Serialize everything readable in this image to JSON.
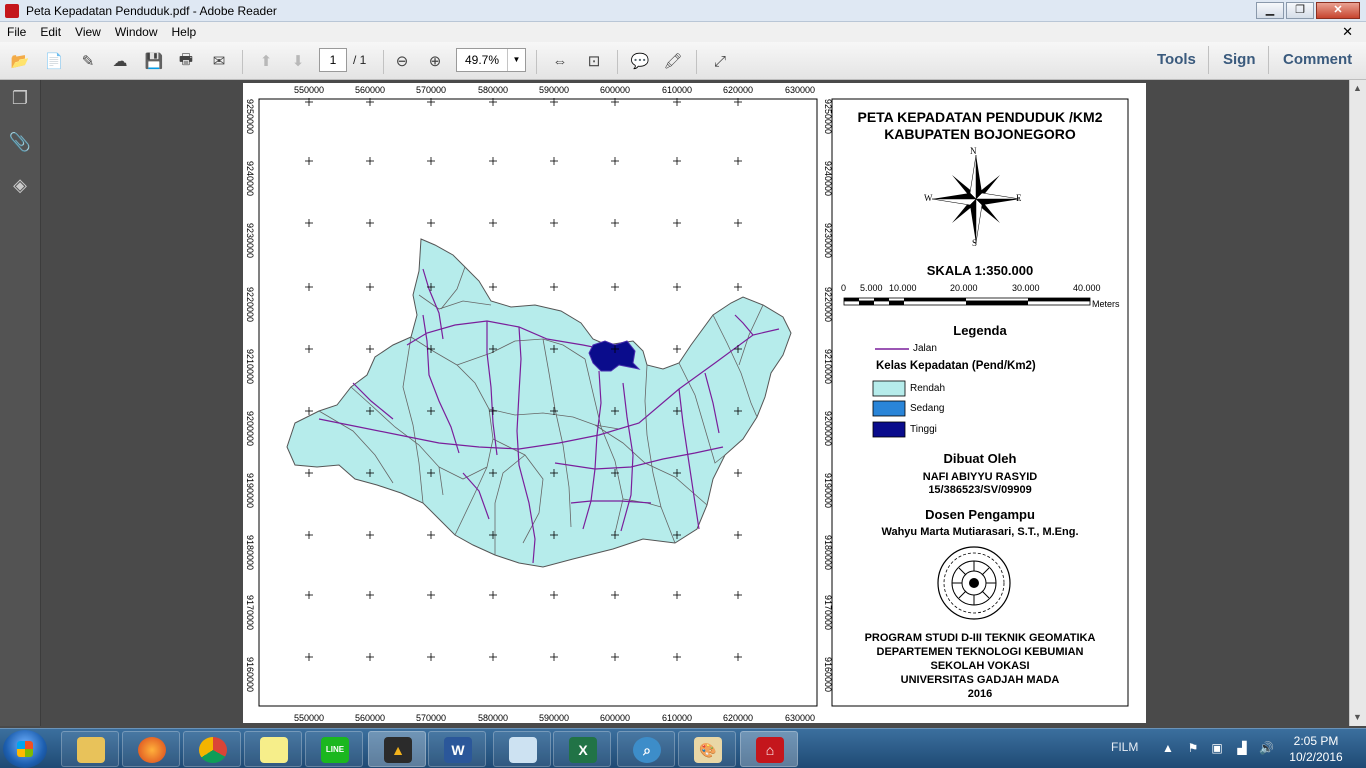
{
  "window": {
    "title": "Peta Kepadatan Penduduk.pdf - Adobe Reader",
    "minimize": "▁",
    "maximize": "❐",
    "close": "✕"
  },
  "menu": [
    "File",
    "Edit",
    "View",
    "Window",
    "Help"
  ],
  "menu_close": "✕",
  "toolbar": {
    "page_current": "1",
    "page_total": "/ 1",
    "zoom": "49.7%",
    "tools_label": "Tools",
    "sign_label": "Sign",
    "comment_label": "Comment"
  },
  "map": {
    "title_line1": "PETA KEPADATAN PENDUDUK /KM2",
    "title_line2": "KABUPATEN BOJONEGORO",
    "compass": {
      "n": "N",
      "s": "S",
      "e": "E",
      "w": "W"
    },
    "scale_title": "SKALA 1:350.000",
    "scale_ticks": [
      "0",
      "5.000",
      "10.000",
      "20.000",
      "30.000",
      "40.000"
    ],
    "scale_unit": "Meters",
    "legend_title": "Legenda",
    "legend_road": "Jalan",
    "density_title": "Kelas Kepadatan (Pend/Km2)",
    "classes": [
      {
        "label": "Rendah",
        "color": "#b6eceb"
      },
      {
        "label": "Sedang",
        "color": "#2a85d8"
      },
      {
        "label": "Tinggi",
        "color": "#0a0c8c"
      }
    ],
    "made_by_title": "Dibuat Oleh",
    "author_name": "NAFI ABIYYU RASYID",
    "author_id": "15/386523/SV/09909",
    "lecturer_title": "Dosen Pengampu",
    "lecturer_name": "Wahyu Marta Mutiarasari, S.T., M.Eng.",
    "institution": [
      "PROGRAM STUDI D-III TEKNIK GEOMATIKA",
      "DEPARTEMEN TEKNOLOGI KEBUMIAN",
      "SEKOLAH VOKASI",
      "UNIVERSITAS GADJAH MADA",
      "2016"
    ],
    "x_ticks": [
      "550000",
      "560000",
      "570000",
      "580000",
      "590000",
      "600000",
      "610000",
      "620000",
      "630000"
    ],
    "y_ticks": [
      "9250000",
      "9240000",
      "9230000",
      "9220000",
      "9210000",
      "9200000",
      "9190000",
      "9180000",
      "9170000",
      "9160000"
    ]
  },
  "taskbar": {
    "apps": [
      "explorer",
      "firefox",
      "chrome",
      "sticky-notes",
      "line",
      "arcgis",
      "word",
      "notepad",
      "excel",
      "search",
      "paint",
      "adobe-reader"
    ],
    "line_label": "LINE",
    "film_label": "FILM",
    "time": "2:05 PM",
    "date": "10/2/2016"
  }
}
